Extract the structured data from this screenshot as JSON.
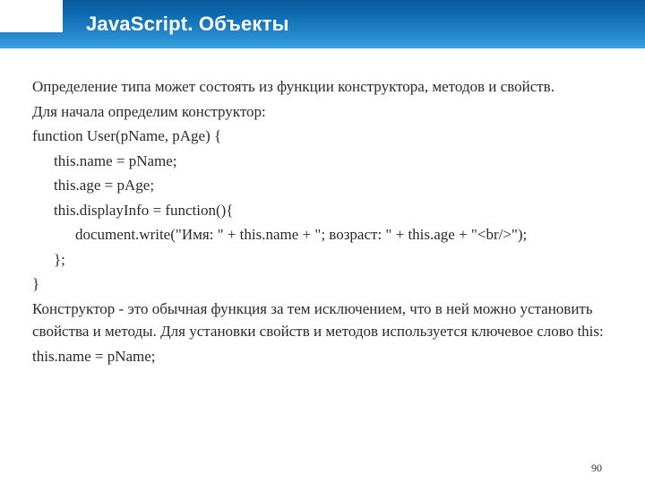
{
  "title": "JavaScript. Объекты",
  "intro1": "Определение типа может состоять из функции конструктора, методов и свойств.",
  "intro2": "Для начала определим конструктор:",
  "code": {
    "l1": "function User(pName, pAge) {",
    "l2": "this.name = pName;",
    "l3": "this.age = pAge;",
    "l4": "this.displayInfo = function(){",
    "l5": "document.write(\"Имя: \" + this.name + \"; возраст: \" + this.age + \"<br/>\");",
    "l6": "};",
    "l7": "}"
  },
  "outro1": "Конструктор - это обычная функция за тем исключением, что в ней можно установить свойства и методы. Для установки свойств и методов используется ключевое слово this:",
  "outro2": "this.name = pName;",
  "page_number": "90"
}
